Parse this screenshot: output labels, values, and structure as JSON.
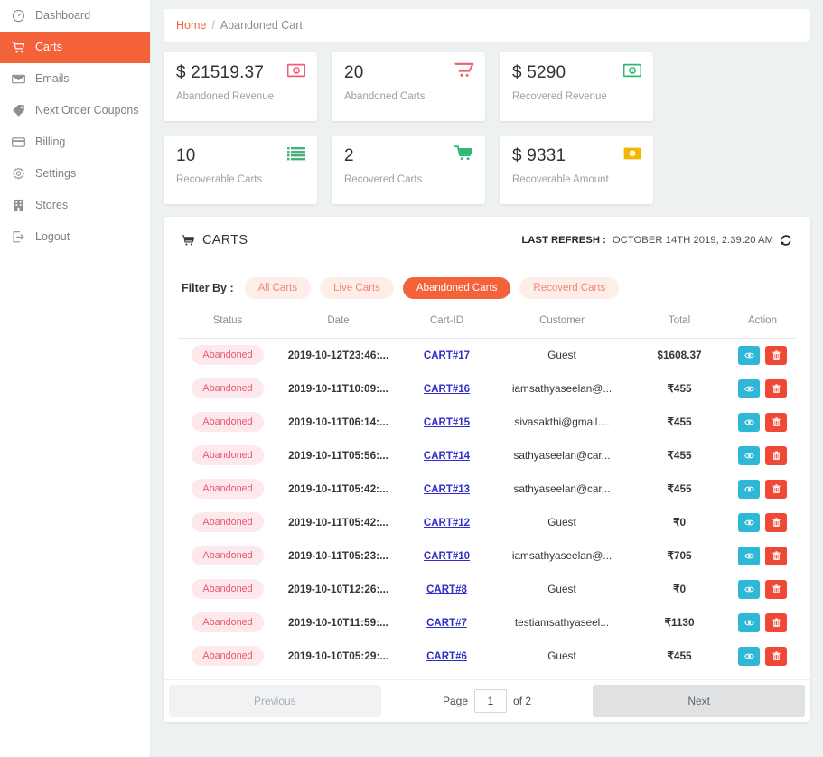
{
  "sidebar": {
    "items": [
      {
        "label": "Dashboard",
        "icon": "dashboard-icon",
        "active": false
      },
      {
        "label": "Carts",
        "icon": "cart-icon",
        "active": true
      },
      {
        "label": "Emails",
        "icon": "envelope-icon",
        "active": false
      },
      {
        "label": "Next Order Coupons",
        "icon": "tag-icon",
        "active": false
      },
      {
        "label": "Billing",
        "icon": "credit-card-icon",
        "active": false
      },
      {
        "label": "Settings",
        "icon": "gear-icon",
        "active": false
      },
      {
        "label": "Stores",
        "icon": "store-icon",
        "active": false
      },
      {
        "label": "Logout",
        "icon": "logout-icon",
        "active": false
      }
    ]
  },
  "breadcrumb": {
    "home": "Home",
    "separator": "/",
    "current": "Abandoned Cart"
  },
  "stat_cards": [
    {
      "value": "$ 21519.37",
      "label": "Abandoned Revenue",
      "icon": "money-bill-icon",
      "color": "#ef5f73"
    },
    {
      "value": "20",
      "label": "Abandoned Carts",
      "icon": "cart-outline-icon",
      "color": "#ef5f73"
    },
    {
      "value": "$ 5290",
      "label": "Recovered Revenue",
      "icon": "money-bill-icon",
      "color": "#2eb872"
    },
    {
      "value": "10",
      "label": "Recoverable Carts",
      "icon": "list-icon",
      "color": "#4caf7d"
    },
    {
      "value": "2",
      "label": "Recovered Carts",
      "icon": "cart-solid-icon",
      "color": "#2eb872"
    },
    {
      "value": "$ 9331",
      "label": "Recoverable Amount",
      "icon": "money-bill-icon",
      "color": "#f2b705"
    }
  ],
  "panel": {
    "title": "CARTS",
    "refresh_label": "LAST REFRESH :",
    "refresh_value": "OCTOBER 14TH 2019, 2:39:20 AM",
    "refresh_icon": "refresh-icon",
    "filter_label": "Filter By :",
    "filters": [
      {
        "label": "All Carts",
        "active": false
      },
      {
        "label": "Live Carts",
        "active": false
      },
      {
        "label": "Abandoned Carts",
        "active": true
      },
      {
        "label": "Recoverd Carts",
        "active": false
      }
    ]
  },
  "table": {
    "columns": [
      "Status",
      "Date",
      "Cart-ID",
      "Customer",
      "Total",
      "Action"
    ],
    "rows": [
      {
        "status": "Abandoned",
        "date": "2019-10-12T23:46:...",
        "cart_id": "CART#17",
        "customer": "Guest",
        "total": "$1608.37"
      },
      {
        "status": "Abandoned",
        "date": "2019-10-11T10:09:...",
        "cart_id": "CART#16",
        "customer": "iamsathyaseelan@...",
        "total": "₹455"
      },
      {
        "status": "Abandoned",
        "date": "2019-10-11T06:14:...",
        "cart_id": "CART#15",
        "customer": "sivasakthi@gmail....",
        "total": "₹455"
      },
      {
        "status": "Abandoned",
        "date": "2019-10-11T05:56:...",
        "cart_id": "CART#14",
        "customer": "sathyaseelan@car...",
        "total": "₹455"
      },
      {
        "status": "Abandoned",
        "date": "2019-10-11T05:42:...",
        "cart_id": "CART#13",
        "customer": "sathyaseelan@car...",
        "total": "₹455"
      },
      {
        "status": "Abandoned",
        "date": "2019-10-11T05:42:...",
        "cart_id": "CART#12",
        "customer": "Guest",
        "total": "₹0"
      },
      {
        "status": "Abandoned",
        "date": "2019-10-11T05:23:...",
        "cart_id": "CART#10",
        "customer": "iamsathyaseelan@...",
        "total": "₹705"
      },
      {
        "status": "Abandoned",
        "date": "2019-10-10T12:26:...",
        "cart_id": "CART#8",
        "customer": "Guest",
        "total": "₹0"
      },
      {
        "status": "Abandoned",
        "date": "2019-10-10T11:59:...",
        "cart_id": "CART#7",
        "customer": "testiamsathyaseel...",
        "total": "₹1130"
      },
      {
        "status": "Abandoned",
        "date": "2019-10-10T05:29:...",
        "cart_id": "CART#6",
        "customer": "Guest",
        "total": "₹455"
      }
    ],
    "action_view_icon": "eye-icon",
    "action_delete_icon": "trash-icon"
  },
  "pagination": {
    "previous": "Previous",
    "page_label": "Page",
    "page_value": "1",
    "of_label": "of 2",
    "next": "Next"
  },
  "colors": {
    "accent": "#f4623a",
    "badge_bg": "#fde9ec",
    "badge_text": "#e8576f",
    "link": "#2f2fc7",
    "view_btn": "#2eb7d6",
    "delete_btn": "#ef4836"
  }
}
